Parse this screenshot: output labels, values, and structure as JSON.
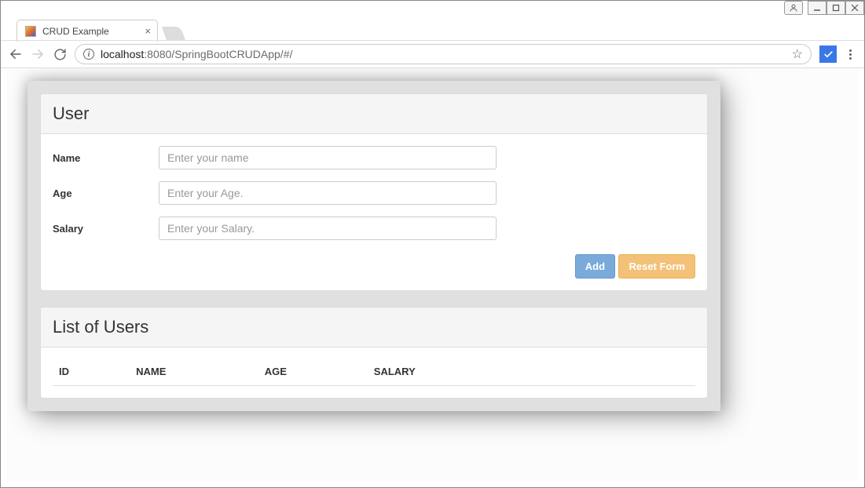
{
  "window_controls": {
    "user_icon": "👤",
    "minimize": "—",
    "maximize": "❐",
    "close": "✕"
  },
  "tab": {
    "title": "CRUD Example"
  },
  "url": {
    "host": "localhost",
    "port_path": ":8080/SpringBootCRUDApp/#/"
  },
  "form": {
    "heading": "User",
    "name": {
      "label": "Name",
      "placeholder": "Enter your name"
    },
    "age": {
      "label": "Age",
      "placeholder": "Enter your Age."
    },
    "salary": {
      "label": "Salary",
      "placeholder": "Enter your Salary."
    },
    "buttons": {
      "add": "Add",
      "reset": "Reset Form"
    }
  },
  "list": {
    "heading": "List of Users",
    "columns": {
      "id": "ID",
      "name": "NAME",
      "age": "AGE",
      "salary": "SALARY"
    },
    "rows": []
  }
}
